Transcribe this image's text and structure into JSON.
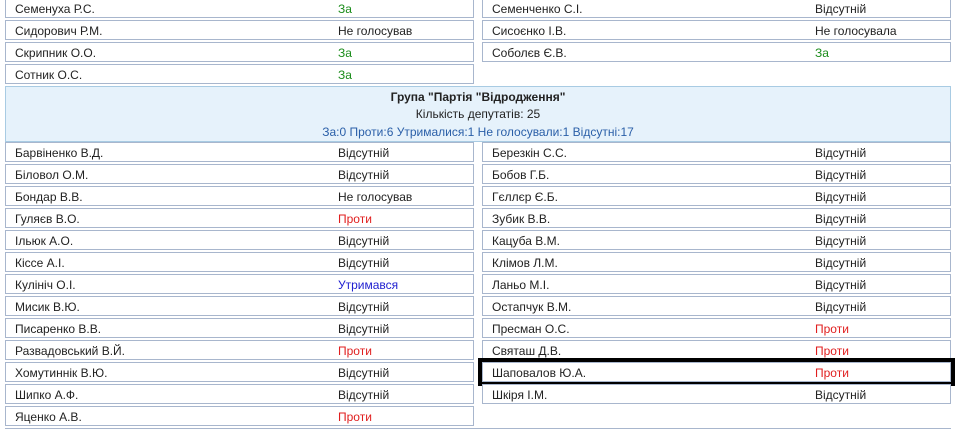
{
  "top_rows": [
    {
      "left": {
        "name": "Семенуха Р.С.",
        "vote": "За",
        "type": "for"
      },
      "right": {
        "name": "Семенченко С.І.",
        "vote": "Відсутній",
        "type": "absent"
      }
    },
    {
      "left": {
        "name": "Сидорович Р.М.",
        "vote": "Не голосував",
        "type": "nv"
      },
      "right": {
        "name": "Сисоєнко І.В.",
        "vote": "Не голосувала",
        "type": "nv"
      }
    },
    {
      "left": {
        "name": "Скрипник О.О.",
        "vote": "За",
        "type": "for"
      },
      "right": {
        "name": "Соболєв Є.В.",
        "vote": "За",
        "type": "for"
      }
    },
    {
      "left": {
        "name": "Сотник О.С.",
        "vote": "За",
        "type": "for"
      },
      "right": null
    }
  ],
  "group": {
    "title": "Група \"Партія \"Відродження\"",
    "count_text": "Кількість депутатів: 25",
    "stats_text": "За:0 Проти:6 Утрималися:1 Не голосували:1 Відсутні:17"
  },
  "group_rows": [
    {
      "left": {
        "name": "Барвіненко В.Д.",
        "vote": "Відсутній",
        "type": "absent"
      },
      "right": {
        "name": "Березкін С.С.",
        "vote": "Відсутній",
        "type": "absent"
      }
    },
    {
      "left": {
        "name": "Біловол О.М.",
        "vote": "Відсутній",
        "type": "absent"
      },
      "right": {
        "name": "Бобов Г.Б.",
        "vote": "Відсутній",
        "type": "absent"
      }
    },
    {
      "left": {
        "name": "Бондар В.В.",
        "vote": "Не голосував",
        "type": "nv"
      },
      "right": {
        "name": "Гєллєр Є.Б.",
        "vote": "Відсутній",
        "type": "absent"
      }
    },
    {
      "left": {
        "name": "Гуляєв В.О.",
        "vote": "Проти",
        "type": "against"
      },
      "right": {
        "name": "Зубик В.В.",
        "vote": "Відсутній",
        "type": "absent"
      }
    },
    {
      "left": {
        "name": "Ільюк А.О.",
        "vote": "Відсутній",
        "type": "absent"
      },
      "right": {
        "name": "Кацуба В.М.",
        "vote": "Відсутній",
        "type": "absent"
      }
    },
    {
      "left": {
        "name": "Кіссе А.І.",
        "vote": "Відсутній",
        "type": "absent"
      },
      "right": {
        "name": "Клімов Л.М.",
        "vote": "Відсутній",
        "type": "absent"
      }
    },
    {
      "left": {
        "name": "Кулініч О.І.",
        "vote": "Утримався",
        "type": "abst"
      },
      "right": {
        "name": "Ланьо М.І.",
        "vote": "Відсутній",
        "type": "absent"
      }
    },
    {
      "left": {
        "name": "Мисик В.Ю.",
        "vote": "Відсутній",
        "type": "absent"
      },
      "right": {
        "name": "Остапчук В.М.",
        "vote": "Відсутній",
        "type": "absent"
      }
    },
    {
      "left": {
        "name": "Писаренко В.В.",
        "vote": "Відсутній",
        "type": "absent"
      },
      "right": {
        "name": "Пресман О.С.",
        "vote": "Проти",
        "type": "against"
      }
    },
    {
      "left": {
        "name": "Развадовський В.Й.",
        "vote": "Проти",
        "type": "against"
      },
      "right": {
        "name": "Святаш Д.В.",
        "vote": "Проти",
        "type": "against"
      }
    },
    {
      "left": {
        "name": "Хомутиннік В.Ю.",
        "vote": "Відсутній",
        "type": "absent"
      },
      "right": {
        "name": "Шаповалов Ю.А.",
        "vote": "Проти",
        "type": "against",
        "highlighted": true
      }
    },
    {
      "left": {
        "name": "Шипко А.Ф.",
        "vote": "Відсутній",
        "type": "absent"
      },
      "right": {
        "name": "Шкіря І.М.",
        "vote": "Відсутній",
        "type": "absent"
      }
    },
    {
      "left": {
        "name": "Яценко А.В.",
        "vote": "Проти",
        "type": "against"
      },
      "right": null
    }
  ],
  "colors": {
    "for": "#1a8c1a",
    "against": "#e01e1e",
    "abstained": "#1e1ed0",
    "group_bg": "#e6f2fb",
    "stats_text": "#2a5fa8",
    "border": "#a8b6cd"
  }
}
